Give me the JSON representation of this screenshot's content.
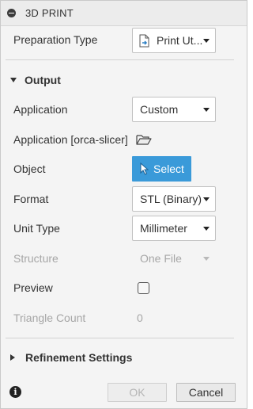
{
  "title": "3D PRINT",
  "preparation": {
    "label": "Preparation Type",
    "value": "Print Ut..."
  },
  "output": {
    "header": "Output",
    "application": {
      "label": "Application",
      "value": "Custom"
    },
    "application_path": {
      "label": "Application [orca-slicer]",
      "icon": "folder-open-icon"
    },
    "object": {
      "label": "Object",
      "button": "Select",
      "icon": "cursor-arrow-icon"
    },
    "format": {
      "label": "Format",
      "value": "STL (Binary)"
    },
    "unit_type": {
      "label": "Unit Type",
      "value": "Millimeter"
    },
    "structure": {
      "label": "Structure",
      "value": "One File"
    },
    "preview": {
      "label": "Preview",
      "checked": false
    },
    "triangle_count": {
      "label": "Triangle Count",
      "value": "0"
    }
  },
  "refinement": {
    "header": "Refinement Settings"
  },
  "footer": {
    "ok": "OK",
    "cancel": "Cancel",
    "info_icon": "i"
  },
  "colors": {
    "accent": "#3a9ad9",
    "disabled_text": "#a6a6a6"
  }
}
